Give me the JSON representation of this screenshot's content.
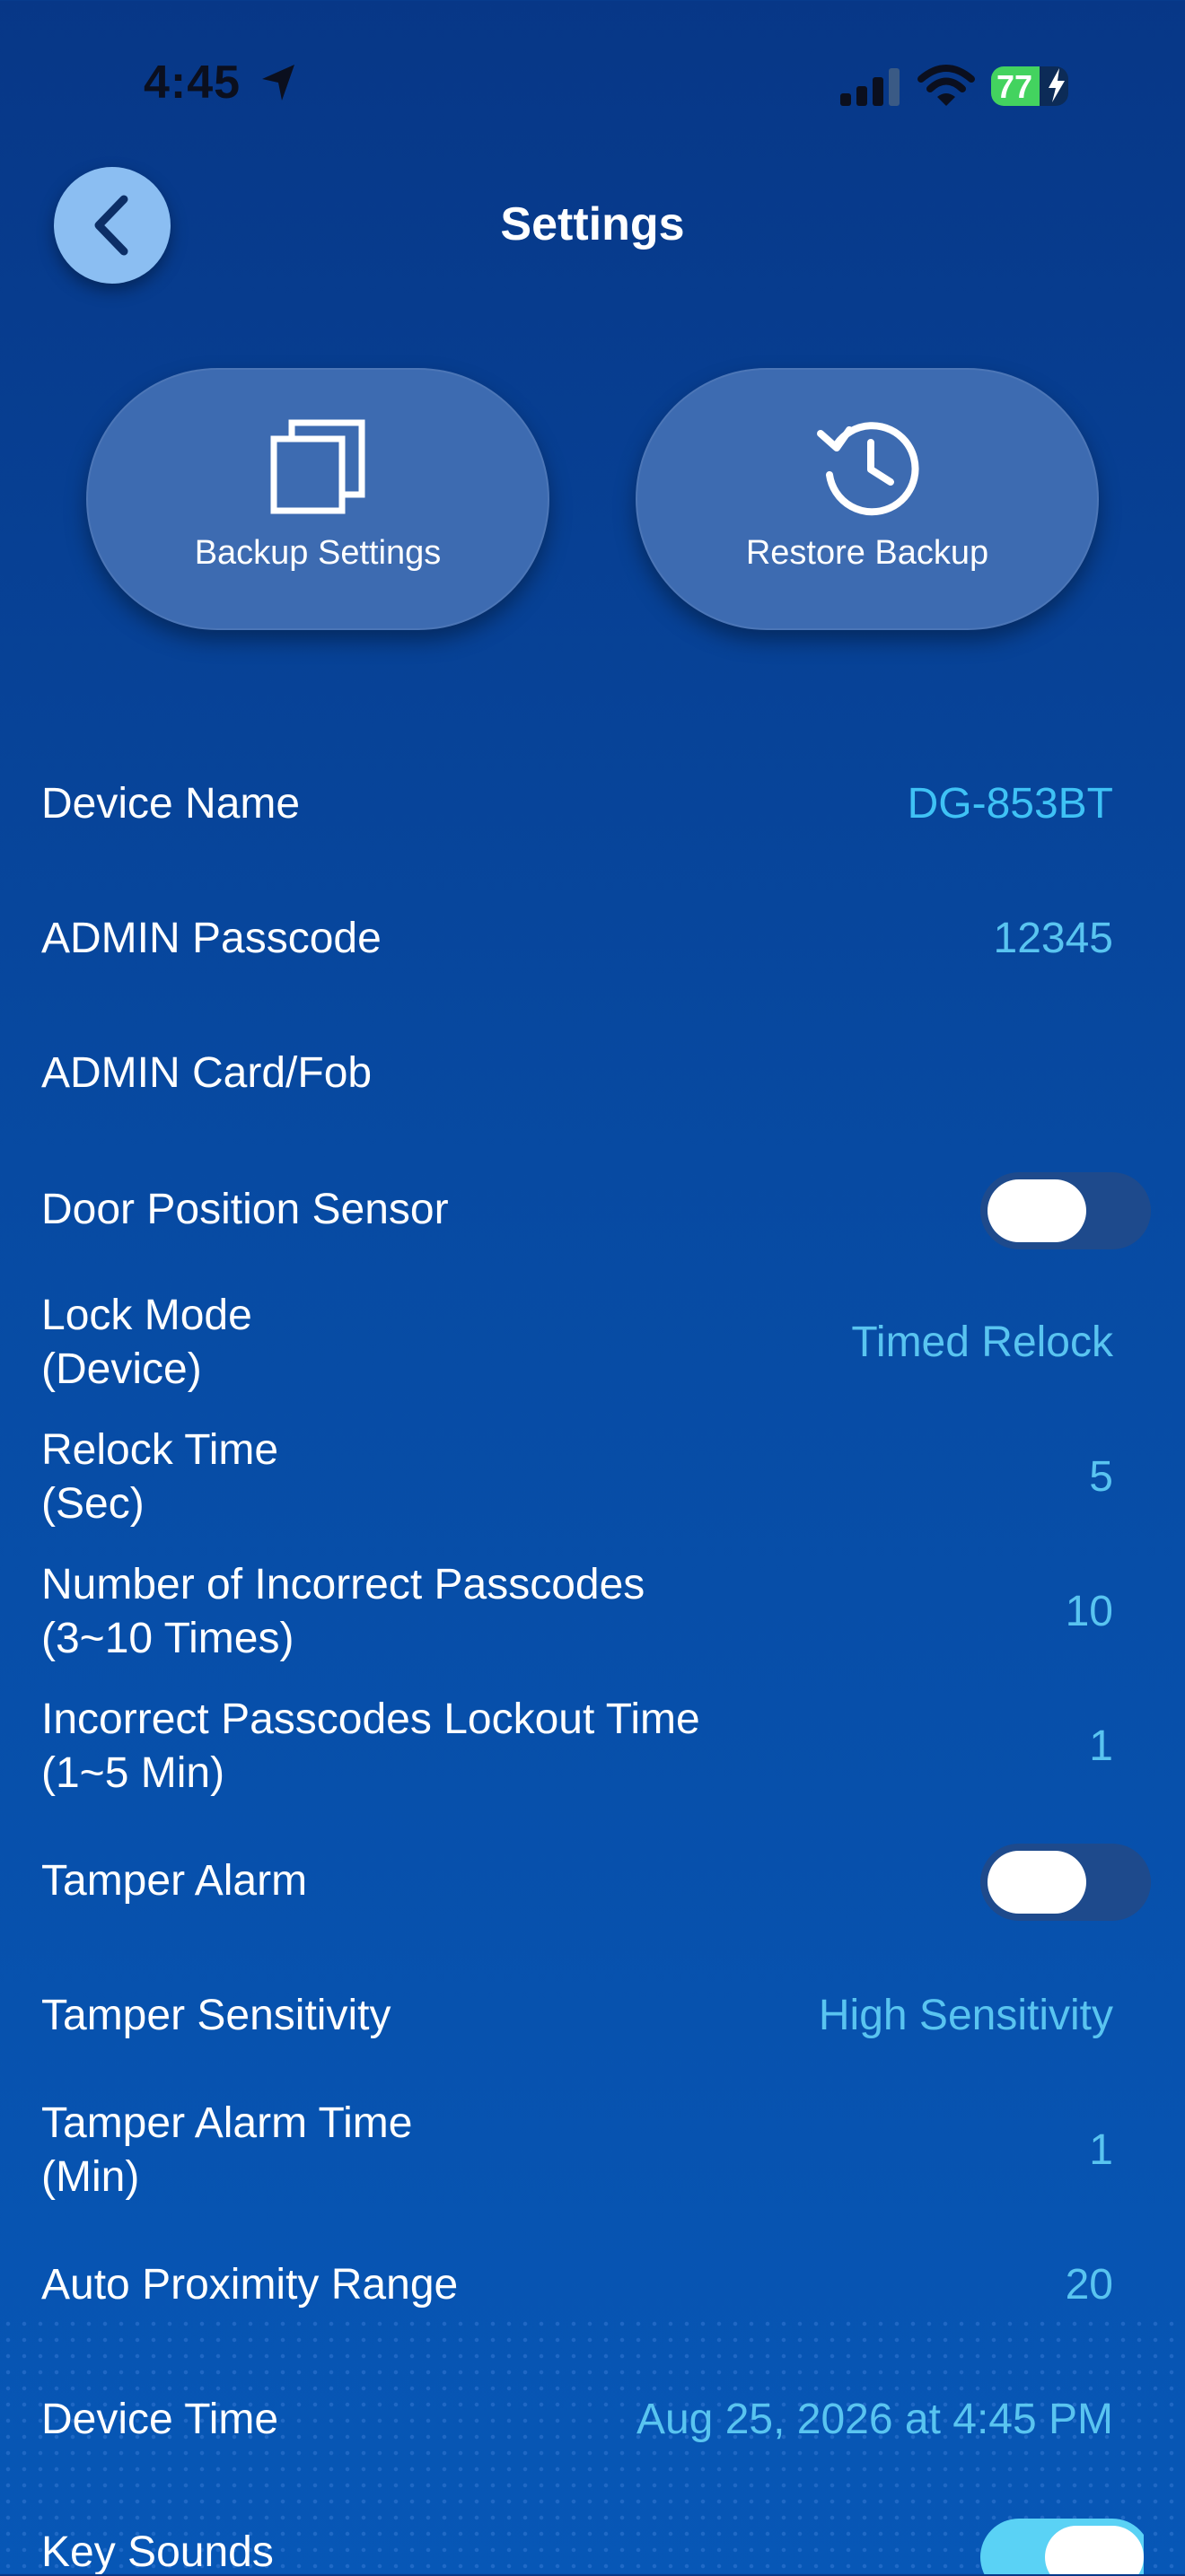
{
  "status_bar": {
    "time": "4:45",
    "battery": "77"
  },
  "header": {
    "title": "Settings"
  },
  "actions": {
    "backup_label": "Backup Settings",
    "restore_label": "Restore Backup"
  },
  "settings": {
    "device_name": {
      "label": "Device Name",
      "value": "DG-853BT"
    },
    "admin_passcode": {
      "label": "ADMIN Passcode",
      "value": "12345"
    },
    "admin_card": {
      "label": "ADMIN Card/Fob"
    },
    "door_sensor": {
      "label": "Door Position Sensor",
      "on": false
    },
    "lock_mode": {
      "label1": "Lock Mode",
      "label2": "(Device)",
      "value": "Timed Relock"
    },
    "relock_time": {
      "label1": "Relock Time",
      "label2": "(Sec)",
      "value": "5"
    },
    "incorrect_count": {
      "label1": "Number of Incorrect Passcodes",
      "label2": "(3~10 Times)",
      "value": "10"
    },
    "lockout_time": {
      "label1": "Incorrect Passcodes Lockout Time",
      "label2": "(1~5 Min)",
      "value": "1"
    },
    "tamper_alarm": {
      "label": "Tamper Alarm",
      "on": false
    },
    "tamper_sensitivity": {
      "label": "Tamper Sensitivity",
      "value": "High Sensitivity"
    },
    "tamper_alarm_time": {
      "label1": "Tamper Alarm Time",
      "label2": "(Min)",
      "value": "1"
    },
    "proximity_range": {
      "label": "Auto Proximity Range",
      "value": "20"
    },
    "device_time": {
      "label": "Device Time",
      "value": "Aug 25, 2026 at 4:45 PM"
    },
    "key_sounds": {
      "label": "Key Sounds",
      "on": true
    }
  },
  "colors": {
    "accent_value": "#59c4f0",
    "toggle_off": "#1e4a8c",
    "toggle_on": "#5ad2f5",
    "battery": "#43d35f"
  }
}
